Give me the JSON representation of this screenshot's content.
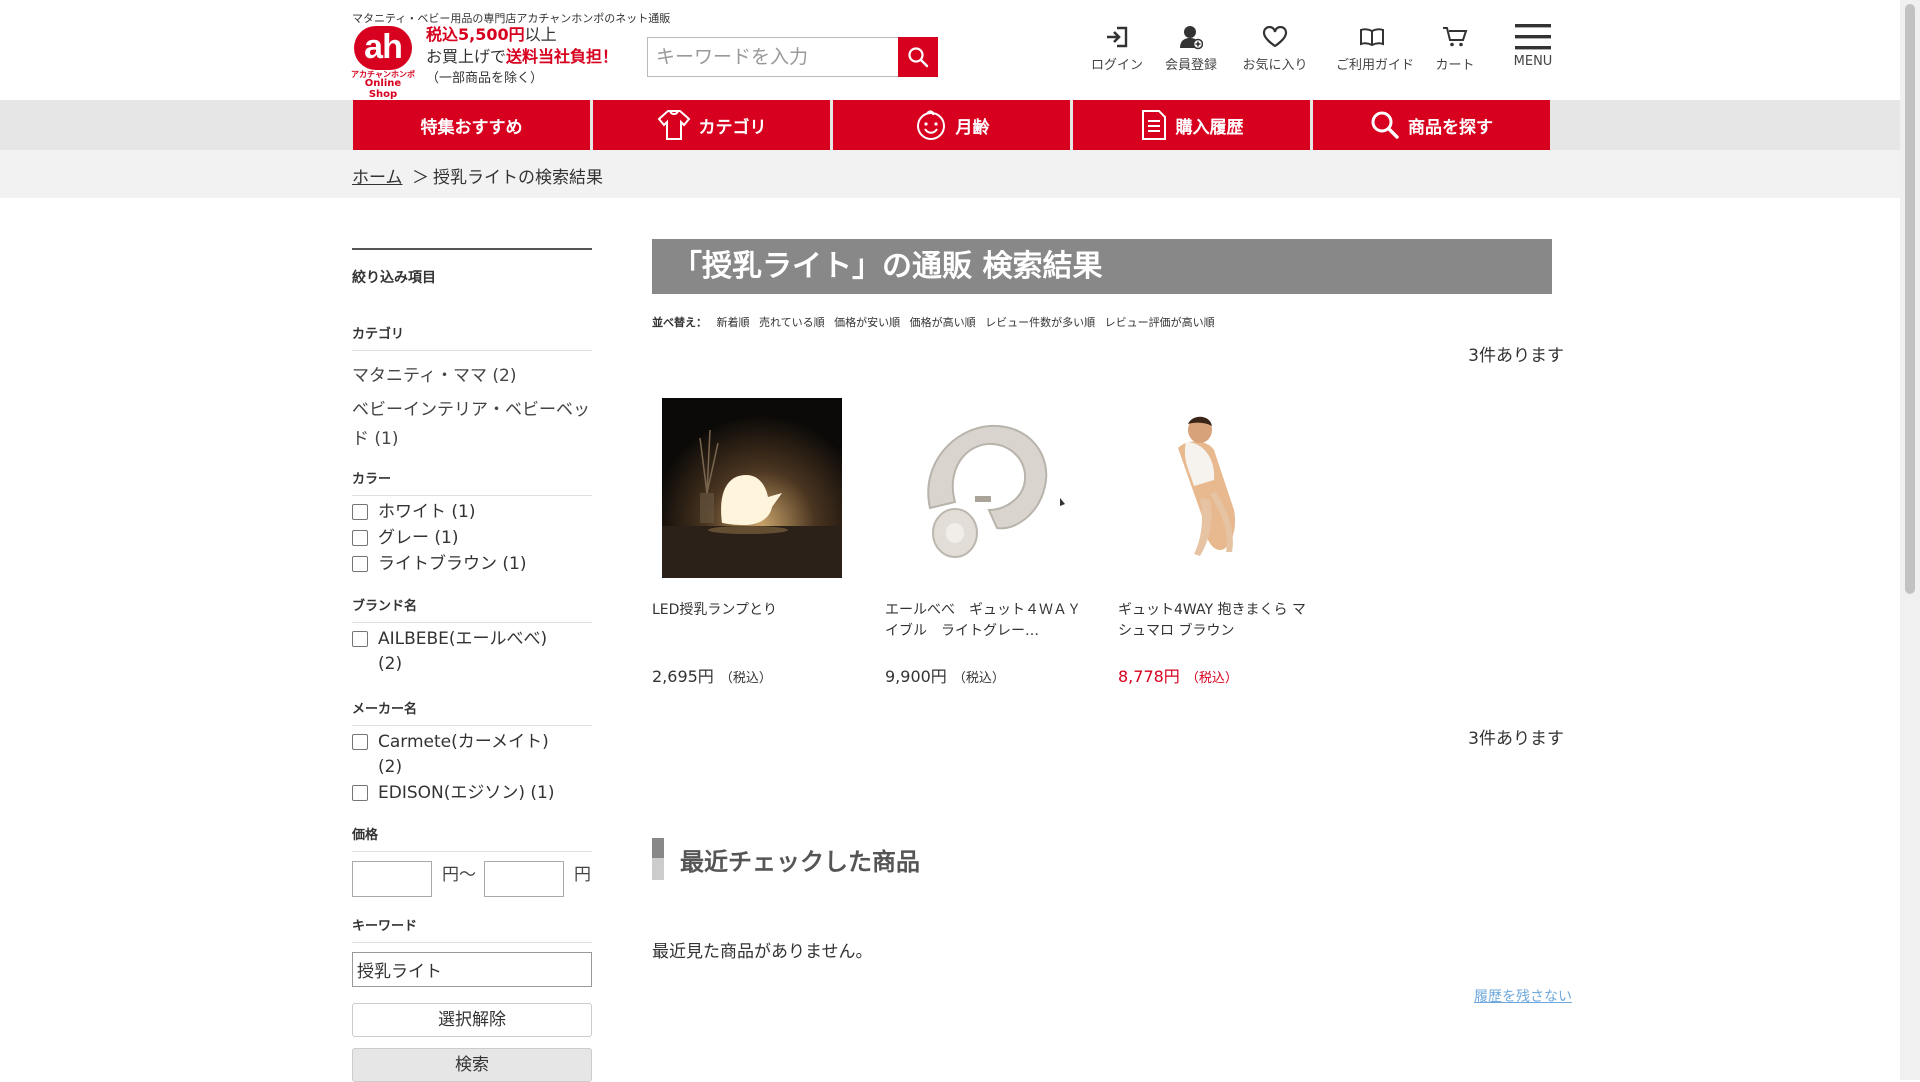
{
  "header": {
    "tagline": "マタニティ・ベビー用品の専門店アカチャンホンポのネット通販",
    "logo": {
      "mark": "ah",
      "small": "アカチャンホンポ",
      "sub": "Online Shop"
    },
    "promo": {
      "line1_red": "税込5,500円",
      "line1_rest": "以上",
      "line2_a": "お買上げで",
      "line2_red": "送料当社負担！",
      "line3": "（一部商品を除く）"
    },
    "search": {
      "placeholder": "キーワードを入力"
    },
    "nav": [
      {
        "label": "ログイン",
        "icon": "login-icon"
      },
      {
        "label": "会員登録",
        "icon": "member-icon"
      },
      {
        "label": "お気に入り",
        "icon": "heart-icon"
      },
      {
        "label": "ご利用ガイド",
        "icon": "book-icon"
      },
      {
        "label": "カート",
        "icon": "cart-icon"
      },
      {
        "label": "MENU",
        "icon": "hamburger-icon"
      }
    ]
  },
  "categories": [
    {
      "label": "特集おすすめ",
      "icon": ""
    },
    {
      "label": "カテゴリ",
      "icon": "baby-clothes-icon"
    },
    {
      "label": "月齢",
      "icon": "baby-face-icon"
    },
    {
      "label": "購入履歴",
      "icon": "document-icon"
    },
    {
      "label": "商品を探す",
      "icon": "search-icon"
    }
  ],
  "breadcrumb": {
    "home": "ホーム",
    "sep": "＞",
    "current": "授乳ライトの検索結果"
  },
  "sidebar": {
    "title": "絞り込み項目",
    "category_head": "カテゴリ",
    "categories": [
      "マタニティ・ママ (2)",
      "ベビーインテリア・ベビーベッド (1)"
    ],
    "color_head": "カラー",
    "colors": [
      "ホワイト (1)",
      "グレー (1)",
      "ライトブラウン (1)"
    ],
    "brand_head": "ブランド名",
    "brands": [
      "AILBEBE(エールべべ) (2)"
    ],
    "maker_head": "メーカー名",
    "makers": [
      "Carmete(カーメイト) (2)",
      "EDISON(エジソン) (1)"
    ],
    "price_head": "価格",
    "price_from_unit": "円～",
    "price_to_unit": "円",
    "keyword_head": "キーワード",
    "keyword_value": "授乳ライト",
    "clear_label": "選択解除",
    "search_label": "検索"
  },
  "main": {
    "title": "「授乳ライト」の通販 検索結果",
    "sort_label": "並べ替え：",
    "sort_options": [
      "新着順",
      "売れている順",
      "価格が安い順",
      "価格が高い順",
      "レビュー件数が多い順",
      "レビュー評価が高い順"
    ],
    "count": "3件あります",
    "products": [
      {
        "name": "LED授乳ランプとり",
        "price": "2,695円",
        "tax": "（税込）",
        "sale": false
      },
      {
        "name": "エールべべ　ギュット４ＷＡＹ　イブル　ライトグレー…",
        "price": "9,900円",
        "tax": "（税込）",
        "sale": false
      },
      {
        "name": "ギュット4WAY 抱きまくら マシュマロ ブラウン",
        "price": "8,778円",
        "tax": "（税込）",
        "sale": true
      }
    ],
    "recent_title": "最近チェックした商品",
    "recent_empty": "最近見た商品がありません。",
    "history_link": "履歴を残さない"
  },
  "colors": {
    "brand_red": "#d7001e",
    "title_gray": "#888888",
    "band_gray": "#e6e6e6"
  }
}
